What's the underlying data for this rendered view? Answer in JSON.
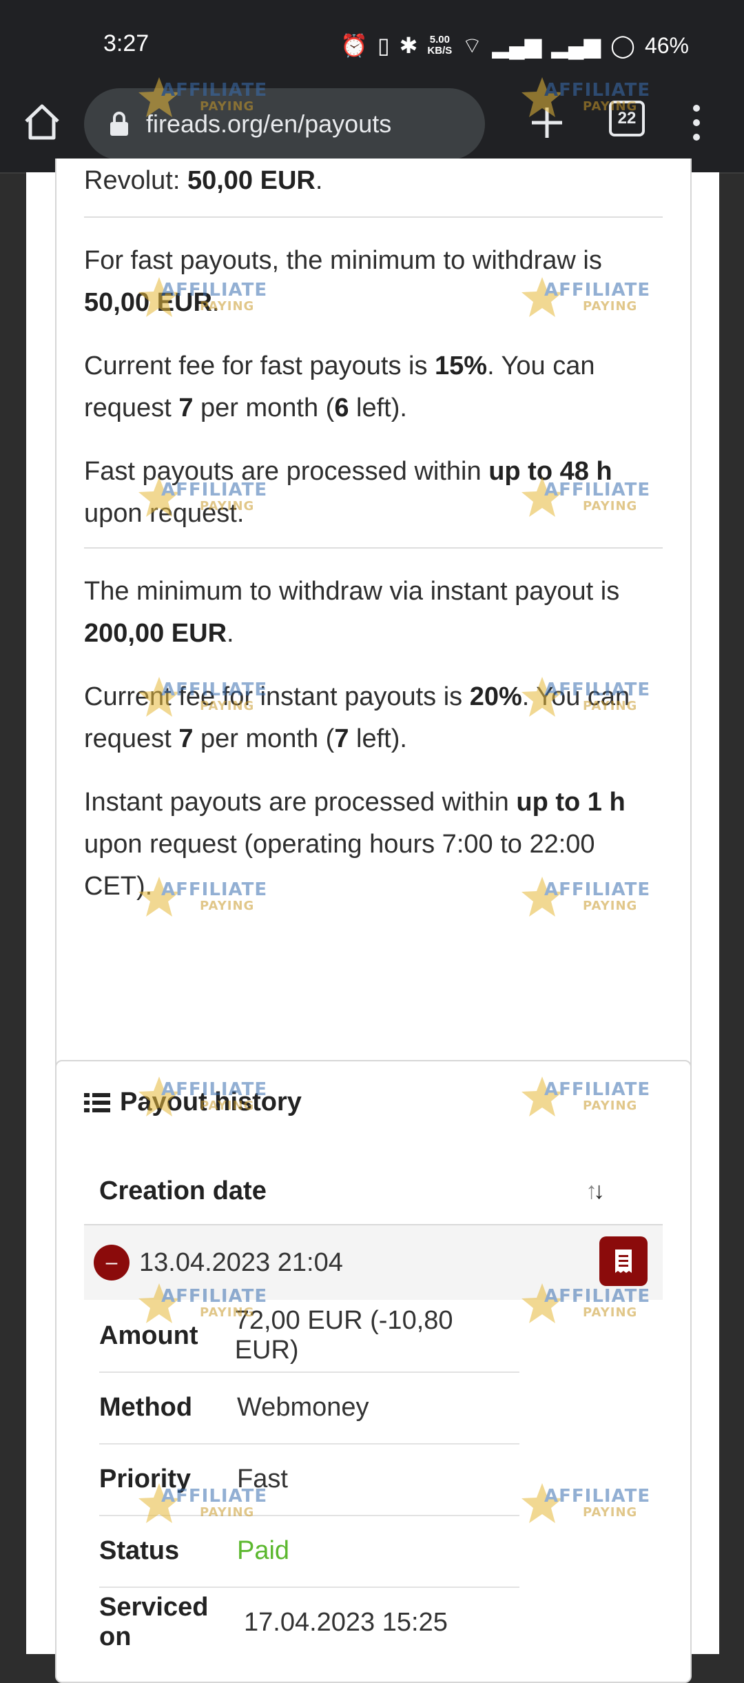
{
  "status": {
    "time": "3:27",
    "net_speed": "5.00",
    "net_unit": "KB/S",
    "battery": "46%"
  },
  "browser": {
    "url": "fireads.org/en/payouts",
    "tab_count": "22"
  },
  "payout_info": {
    "revolut_prefix": "Revolut: ",
    "revolut_value": "50,00 EUR",
    "revolut_suffix": ".",
    "fast_min_prefix": "For fast payouts, the minimum to withdraw is ",
    "fast_min_value": "50,00 EUR",
    "fast_min_suffix": ".",
    "fast_fee_prefix": "Current fee for fast payouts is ",
    "fast_fee_value": "15%",
    "fast_fee_mid": ". You can request ",
    "fast_per_month": "7",
    "fast_per_month_mid": " per month (",
    "fast_left": "6",
    "fast_left_suffix": " left).",
    "fast_time_prefix": "Fast payouts are processed within ",
    "fast_time_value": "up to 48 h",
    "fast_time_suffix": " upon request.",
    "instant_min_prefix": "The minimum to withdraw via instant payout is ",
    "instant_min_value": "200,00 EUR",
    "instant_min_suffix": ".",
    "instant_fee_prefix": "Current fee for instant payouts is ",
    "instant_fee_value": "20%",
    "instant_fee_mid": ". You can request ",
    "instant_per_month": "7",
    "instant_per_month_mid": " per month (",
    "instant_left": "7",
    "instant_left_suffix": " left).",
    "instant_time_prefix": "Instant payouts are processed within ",
    "instant_time_value": "up to 1 h",
    "instant_time_suffix": " upon request (operating hours 7:00 to 22:00 CET)."
  },
  "history": {
    "title": "Payout history",
    "column_header": "Creation date",
    "row": {
      "date": "13.04.2023 21:04",
      "details": [
        {
          "key": "Amount",
          "value": "72,00 EUR (-10,80 EUR)"
        },
        {
          "key": "Method",
          "value": "Webmoney"
        },
        {
          "key": "Priority",
          "value": "Fast"
        },
        {
          "key": "Status",
          "value": "Paid"
        },
        {
          "key": "Serviced on",
          "value": "17.04.2023 15:25"
        }
      ]
    }
  },
  "watermark": {
    "line1": "AFFILIATE",
    "line2": "PAYING"
  },
  "colors": {
    "accent_red": "#8b0b0b",
    "paid_green": "#5cb82f",
    "browser_bg": "#202124"
  }
}
